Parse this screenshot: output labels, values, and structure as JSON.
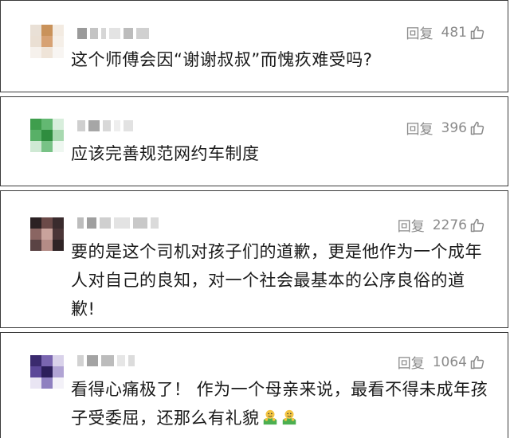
{
  "comments": [
    {
      "reply_label": "回复",
      "likes": "481",
      "text": "这个师傅会因“谢谢叔叔”而愧疚难受吗?",
      "avatar_colors": [
        "#e9e0d6",
        "#c9925a",
        "#f3ebe2",
        "#eadfd3",
        "#d7a274",
        "#f5efe8",
        "#f6f1ec",
        "#efe4d8",
        "#f8f5f2"
      ]
    },
    {
      "reply_label": "回复",
      "likes": "396",
      "text": "应该完善规范网约车制度",
      "avatar_colors": [
        "#3f9e4d",
        "#63b872",
        "#d8eedc",
        "#58b067",
        "#2f8d3f",
        "#a8d9b0",
        "#cfe9d4",
        "#78c286",
        "#eef7f0"
      ]
    },
    {
      "reply_label": "回复",
      "likes": "2276",
      "text": "要的是这个司机对孩子们的道歉，更是他作为一个成年人对自己的良知，对一个社会最基本的公序良俗的道歉!",
      "avatar_colors": [
        "#2b2123",
        "#6b4a48",
        "#3a2b2d",
        "#8a6562",
        "#c9a39c",
        "#4b3537",
        "#5a4344",
        "#b48c86",
        "#2f2426"
      ]
    },
    {
      "reply_label": "回复",
      "likes": "1064",
      "text": "看得心痛极了！ 作为一个母亲来说，最看不得未成年孩子受委屈，还那么有礼貌",
      "avatar_colors": [
        "#3a2a6e",
        "#7a66b0",
        "#d9d2ea",
        "#5b4798",
        "#2c1f5a",
        "#b1a4d4",
        "#e9e5f3",
        "#8f80c0",
        "#f3f1f8"
      ]
    }
  ]
}
